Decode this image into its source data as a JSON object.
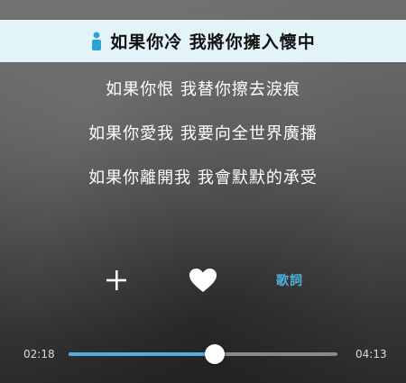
{
  "lyrics": {
    "current_line": "如果你冷 我將你擁入懷中",
    "lines": [
      "如果你恨 我替你擦去淚痕",
      "如果你愛我 我要向全世界廣播",
      "如果你離開我 我會默默的承受"
    ]
  },
  "controls": {
    "add_icon": "plus-icon",
    "favorite_icon": "heart-icon",
    "lyrics_label": "歌詞"
  },
  "progress": {
    "current_time": "02:18",
    "total_time": "04:13",
    "fraction": 0.545
  },
  "colors": {
    "accent": "#4db1dc",
    "current_line_bg": "#e3f4f8"
  }
}
